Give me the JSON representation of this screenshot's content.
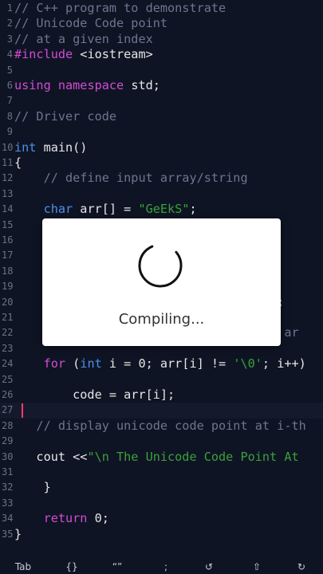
{
  "editor": {
    "lines": [
      {
        "n": "1",
        "tokens": [
          {
            "t": "// C++ program to demonstrate",
            "c": "comment"
          }
        ]
      },
      {
        "n": "2",
        "tokens": [
          {
            "t": "// Unicode Code point",
            "c": "comment"
          }
        ]
      },
      {
        "n": "3",
        "tokens": [
          {
            "t": "// at a given index",
            "c": "comment"
          }
        ]
      },
      {
        "n": "4",
        "tokens": [
          {
            "t": "#include",
            "c": "keyword"
          },
          {
            "t": " <iostream>",
            "c": "default"
          }
        ]
      },
      {
        "n": "5",
        "tokens": []
      },
      {
        "n": "6",
        "tokens": [
          {
            "t": "using",
            "c": "keyword"
          },
          {
            "t": " ",
            "c": "default"
          },
          {
            "t": "namespace",
            "c": "keyword"
          },
          {
            "t": " std;",
            "c": "default"
          }
        ]
      },
      {
        "n": "7",
        "tokens": []
      },
      {
        "n": "8",
        "tokens": [
          {
            "t": "// Driver code",
            "c": "comment"
          }
        ]
      },
      {
        "n": "9",
        "tokens": []
      },
      {
        "n": "10",
        "tokens": [
          {
            "t": "int",
            "c": "type"
          },
          {
            "t": " main()",
            "c": "default"
          }
        ]
      },
      {
        "n": "11",
        "tokens": [
          {
            "t": "{",
            "c": "default"
          }
        ]
      },
      {
        "n": "12",
        "tokens": [
          {
            "t": "    // define input array/string",
            "c": "comment"
          }
        ]
      },
      {
        "n": "13",
        "tokens": []
      },
      {
        "n": "14",
        "tokens": [
          {
            "t": "    ",
            "c": "default"
          },
          {
            "t": "char",
            "c": "type"
          },
          {
            "t": " arr[] = ",
            "c": "default"
          },
          {
            "t": "\"GeEkS\"",
            "c": "string"
          },
          {
            "t": ";",
            "c": "default"
          }
        ]
      },
      {
        "n": "15",
        "tokens": []
      },
      {
        "n": "16",
        "tokens": []
      },
      {
        "n": "17",
        "tokens": []
      },
      {
        "n": "18",
        "tokens": []
      },
      {
        "n": "19",
        "tokens": []
      },
      {
        "n": "20",
        "tokens": [
          {
            "t": "                                 arr;",
            "c": "default"
          }
        ]
      },
      {
        "n": "21",
        "tokens": []
      },
      {
        "n": "22",
        "tokens": [
          {
            "t": "                                 the ar",
            "c": "comment"
          }
        ]
      },
      {
        "n": "23",
        "tokens": []
      },
      {
        "n": "24",
        "tokens": [
          {
            "t": "    ",
            "c": "default"
          },
          {
            "t": "for",
            "c": "keyword"
          },
          {
            "t": " (",
            "c": "default"
          },
          {
            "t": "int",
            "c": "type"
          },
          {
            "t": " i = 0; arr[i] != ",
            "c": "default"
          },
          {
            "t": "'\\0'",
            "c": "string"
          },
          {
            "t": "; i++)",
            "c": "default"
          }
        ]
      },
      {
        "n": "25",
        "tokens": []
      },
      {
        "n": "26",
        "tokens": [
          {
            "t": "        code = arr[i];",
            "c": "default"
          }
        ]
      },
      {
        "n": "27",
        "tokens": []
      },
      {
        "n": "28",
        "tokens": [
          {
            "t": "   // display unicode code point at i-th",
            "c": "comment"
          }
        ]
      },
      {
        "n": "29",
        "tokens": []
      },
      {
        "n": "30",
        "tokens": [
          {
            "t": "   cout <<",
            "c": "default"
          },
          {
            "t": "\"\\n The Unicode Code Point At",
            "c": "string"
          }
        ]
      },
      {
        "n": "31",
        "tokens": []
      },
      {
        "n": "32",
        "tokens": [
          {
            "t": "    }",
            "c": "default"
          }
        ]
      },
      {
        "n": "33",
        "tokens": []
      },
      {
        "n": "34",
        "tokens": [
          {
            "t": "    ",
            "c": "default"
          },
          {
            "t": "return",
            "c": "keyword"
          },
          {
            "t": " 0;",
            "c": "default"
          }
        ]
      },
      {
        "n": "35",
        "tokens": [
          {
            "t": "}",
            "c": "default"
          }
        ]
      }
    ]
  },
  "dialog": {
    "status_text": "Compiling..."
  },
  "keybar": {
    "keys": [
      {
        "label": "Tab",
        "icon": "tab-key"
      },
      {
        "label": "{}",
        "icon": "braces-key"
      },
      {
        "label": "“”",
        "icon": "quotes-key"
      },
      {
        "label": ";",
        "icon": "semicolon-key"
      },
      {
        "label": "↺",
        "icon": "undo-icon"
      },
      {
        "label": "⇧",
        "icon": "shift-arrow-icon"
      },
      {
        "label": "↻",
        "icon": "redo-icon"
      }
    ]
  },
  "colors": {
    "background": "#0f1424",
    "comment": "#6c7691",
    "keyword": "#d24cd2",
    "type": "#4d8fe8",
    "string": "#3aa13a",
    "caret": "#ff3b6b"
  }
}
